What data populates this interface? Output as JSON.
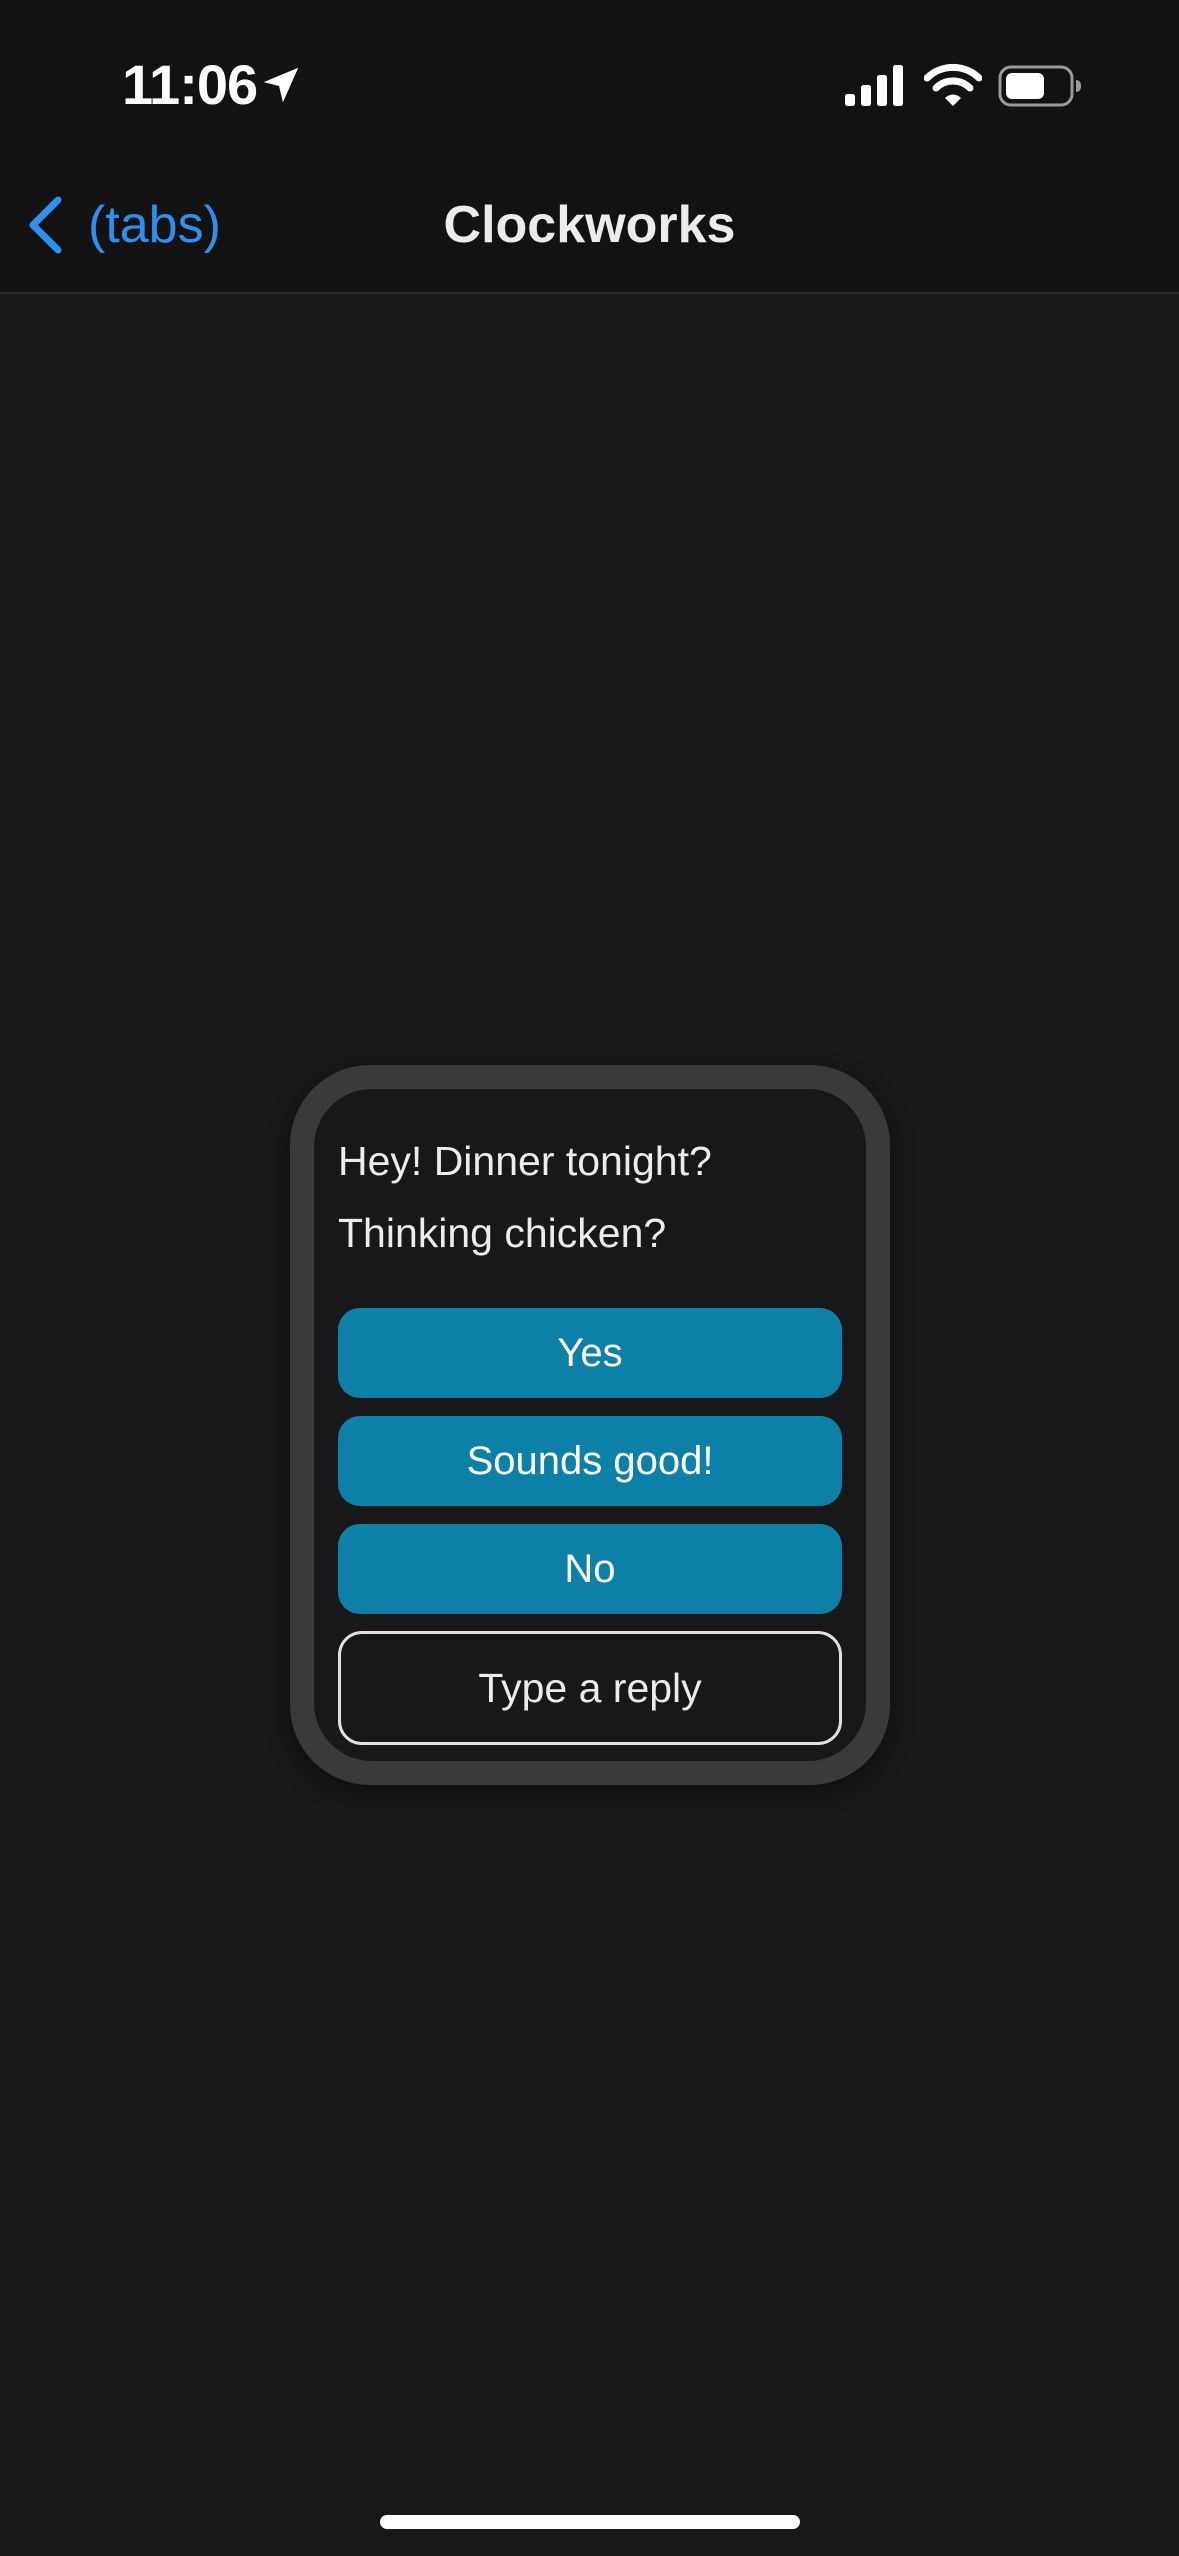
{
  "status_bar": {
    "time": "11:06",
    "icons": [
      "location-arrow-icon",
      "cellular-signal-icon",
      "wifi-icon",
      "battery-icon"
    ]
  },
  "nav": {
    "back_label": "(tabs)",
    "title": "Clockworks",
    "back_icon": "chevron-left-icon"
  },
  "watch": {
    "message_lines": [
      "Hey! Dinner tonight?",
      "Thinking chicken?"
    ],
    "replies": [
      "Yes",
      "Sounds good!",
      "No"
    ],
    "type_reply_label": "Type a reply"
  },
  "colors": {
    "accent": "#2f8ff0",
    "reply_button": "#0d80a8",
    "background": "#17181a",
    "bar_background": "#121212",
    "watch_bezel": "#3a3a3a"
  }
}
